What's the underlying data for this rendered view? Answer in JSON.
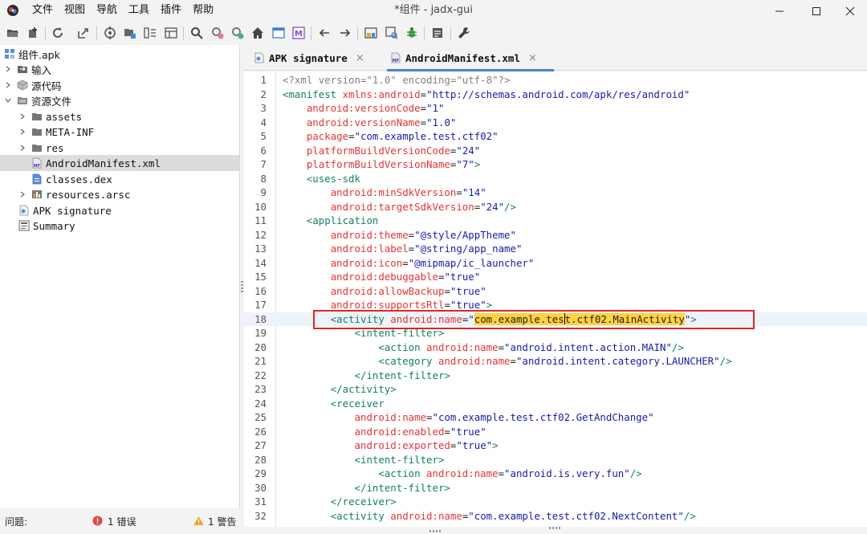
{
  "window": {
    "title": "*组件 - jadx-gui",
    "menu": [
      "文件",
      "视图",
      "导航",
      "工具",
      "插件",
      "帮助"
    ]
  },
  "toolbar": {
    "icons": [
      "open-file-icon",
      "add-files-icon",
      "reload-icon",
      "export-icon",
      "sync-icon",
      "deobfuscation-icon",
      "flatten-packages-icon",
      "columns-icon",
      "search-icon",
      "find-usage-icon",
      "find-class-icon",
      "home-icon",
      "window-icon",
      "smali-icon",
      "back-icon",
      "forward-icon",
      "log-viewer-icon",
      "quick-tab-icon",
      "debugger-icon",
      "console-icon",
      "settings-wrench-icon"
    ]
  },
  "tree": {
    "items": [
      {
        "label": "组件.apk",
        "icon": "apk-icon",
        "level": 0,
        "expandable": false
      },
      {
        "label": "输入",
        "icon": "inputs-icon",
        "level": 0,
        "expandable": true
      },
      {
        "label": "源代码",
        "icon": "package-icon",
        "level": 0,
        "expandable": true
      },
      {
        "label": "资源文件",
        "icon": "resources-folder-icon",
        "level": 0,
        "expandable": true,
        "expanded": true
      },
      {
        "label": "assets",
        "icon": "folder-icon",
        "level": 1,
        "expandable": true
      },
      {
        "label": "META-INF",
        "icon": "folder-icon",
        "level": 1,
        "expandable": true
      },
      {
        "label": "res",
        "icon": "folder-icon",
        "level": 1,
        "expandable": true
      },
      {
        "label": "AndroidManifest.xml",
        "icon": "manifest-file-icon",
        "level": 1,
        "expandable": false,
        "selected": true
      },
      {
        "label": "classes.dex",
        "icon": "dex-file-icon",
        "level": 1,
        "expandable": false
      },
      {
        "label": "resources.arsc",
        "icon": "arsc-file-icon",
        "level": 1,
        "expandable": true
      },
      {
        "label": "APK signature",
        "icon": "certificate-icon",
        "level": 0,
        "expandable": false
      },
      {
        "label": "Summary",
        "icon": "summary-icon",
        "level": 0,
        "expandable": false
      }
    ]
  },
  "tabs": [
    {
      "label": "APK signature",
      "icon": "certificate-icon",
      "close": "×",
      "active": false
    },
    {
      "label": "AndroidManifest.xml",
      "icon": "manifest-file-icon",
      "close": "×",
      "active": true
    }
  ],
  "editor": {
    "current_line": 18,
    "lines": [
      {
        "n": "1",
        "indent": 0,
        "tokens": [
          [
            "pi",
            "<?xml version=\"1.0\" encoding=\"utf-8\"?>"
          ]
        ]
      },
      {
        "n": "2",
        "indent": 0,
        "tokens": [
          [
            "tag",
            "<manifest"
          ],
          [
            "sp",
            " "
          ],
          [
            "attr",
            "xmlns:android"
          ],
          [
            "eq",
            "="
          ],
          [
            "str",
            "\"http://schemas.android.com/apk/res/android\""
          ]
        ]
      },
      {
        "n": "3",
        "indent": 4,
        "tokens": [
          [
            "attr",
            "android:versionCode"
          ],
          [
            "eq",
            "="
          ],
          [
            "str",
            "\"1\""
          ]
        ]
      },
      {
        "n": "4",
        "indent": 4,
        "tokens": [
          [
            "attr",
            "android:versionName"
          ],
          [
            "eq",
            "="
          ],
          [
            "str",
            "\"1.0\""
          ]
        ]
      },
      {
        "n": "5",
        "indent": 4,
        "tokens": [
          [
            "attr",
            "package"
          ],
          [
            "eq",
            "="
          ],
          [
            "str",
            "\"com.example.test.ctf02\""
          ]
        ]
      },
      {
        "n": "6",
        "indent": 4,
        "tokens": [
          [
            "attr",
            "platformBuildVersionCode"
          ],
          [
            "eq",
            "="
          ],
          [
            "str",
            "\"24\""
          ]
        ]
      },
      {
        "n": "7",
        "indent": 4,
        "tokens": [
          [
            "attr",
            "platformBuildVersionName"
          ],
          [
            "eq",
            "="
          ],
          [
            "str",
            "\"7\""
          ],
          [
            "tag",
            ">"
          ]
        ]
      },
      {
        "n": "8",
        "indent": 4,
        "tokens": [
          [
            "tag",
            "<uses-sdk"
          ]
        ]
      },
      {
        "n": "9",
        "indent": 8,
        "tokens": [
          [
            "attr",
            "android:minSdkVersion"
          ],
          [
            "eq",
            "="
          ],
          [
            "str",
            "\"14\""
          ]
        ]
      },
      {
        "n": "10",
        "indent": 8,
        "tokens": [
          [
            "attr",
            "android:targetSdkVersion"
          ],
          [
            "eq",
            "="
          ],
          [
            "str",
            "\"24\""
          ],
          [
            "tag",
            "/>"
          ]
        ]
      },
      {
        "n": "11",
        "indent": 4,
        "tokens": [
          [
            "tag",
            "<application"
          ]
        ]
      },
      {
        "n": "12",
        "indent": 8,
        "tokens": [
          [
            "attr",
            "android:theme"
          ],
          [
            "eq",
            "="
          ],
          [
            "str",
            "\"@style/AppTheme\""
          ]
        ]
      },
      {
        "n": "13",
        "indent": 8,
        "tokens": [
          [
            "attr",
            "android:label"
          ],
          [
            "eq",
            "="
          ],
          [
            "str",
            "\"@string/app_name\""
          ]
        ]
      },
      {
        "n": "14",
        "indent": 8,
        "tokens": [
          [
            "attr",
            "android:icon"
          ],
          [
            "eq",
            "="
          ],
          [
            "str",
            "\"@mipmap/ic_launcher\""
          ]
        ]
      },
      {
        "n": "15",
        "indent": 8,
        "tokens": [
          [
            "attr",
            "android:debuggable"
          ],
          [
            "eq",
            "="
          ],
          [
            "str",
            "\"true\""
          ]
        ]
      },
      {
        "n": "16",
        "indent": 8,
        "tokens": [
          [
            "attr",
            "android:allowBackup"
          ],
          [
            "eq",
            "="
          ],
          [
            "str",
            "\"true\""
          ]
        ]
      },
      {
        "n": "17",
        "indent": 8,
        "tokens": [
          [
            "attr",
            "android:supportsRtl"
          ],
          [
            "eq",
            "="
          ],
          [
            "str",
            "\"true\""
          ],
          [
            "tag",
            ">"
          ]
        ]
      },
      {
        "n": "18",
        "indent": 8,
        "tokens": [
          [
            "tag",
            "<activity"
          ],
          [
            "sp",
            " "
          ],
          [
            "attr",
            "android:name"
          ],
          [
            "eq",
            "="
          ],
          [
            "str",
            "\""
          ],
          [
            "sel",
            "com.example.tes"
          ],
          [
            "caret",
            ""
          ],
          [
            "sel",
            "t.ctf02.MainActivity"
          ],
          [
            "str",
            "\""
          ],
          [
            "tag",
            ">"
          ]
        ]
      },
      {
        "n": "19",
        "indent": 12,
        "tokens": [
          [
            "tag",
            "<intent-filter>"
          ]
        ]
      },
      {
        "n": "20",
        "indent": 16,
        "tokens": [
          [
            "tag",
            "<action"
          ],
          [
            "sp",
            " "
          ],
          [
            "attr",
            "android:name"
          ],
          [
            "eq",
            "="
          ],
          [
            "str",
            "\"android.intent.action.MAIN\""
          ],
          [
            "tag",
            "/>"
          ]
        ]
      },
      {
        "n": "21",
        "indent": 16,
        "tokens": [
          [
            "tag",
            "<category"
          ],
          [
            "sp",
            " "
          ],
          [
            "attr",
            "android:name"
          ],
          [
            "eq",
            "="
          ],
          [
            "str",
            "\"android.intent.category.LAUNCHER\""
          ],
          [
            "tag",
            "/>"
          ]
        ]
      },
      {
        "n": "22",
        "indent": 12,
        "tokens": [
          [
            "tag",
            "</intent-filter>"
          ]
        ]
      },
      {
        "n": "23",
        "indent": 8,
        "tokens": [
          [
            "tag",
            "</activity>"
          ]
        ]
      },
      {
        "n": "24",
        "indent": 8,
        "tokens": [
          [
            "tag",
            "<receiver"
          ]
        ]
      },
      {
        "n": "25",
        "indent": 12,
        "tokens": [
          [
            "attr",
            "android:name"
          ],
          [
            "eq",
            "="
          ],
          [
            "str",
            "\"com.example.test.ctf02.GetAndChange\""
          ]
        ]
      },
      {
        "n": "26",
        "indent": 12,
        "tokens": [
          [
            "attr",
            "android:enabled"
          ],
          [
            "eq",
            "="
          ],
          [
            "str",
            "\"true\""
          ]
        ]
      },
      {
        "n": "27",
        "indent": 12,
        "tokens": [
          [
            "attr",
            "android:exported"
          ],
          [
            "eq",
            "="
          ],
          [
            "str",
            "\"true\""
          ],
          [
            "tag",
            ">"
          ]
        ]
      },
      {
        "n": "28",
        "indent": 12,
        "tokens": [
          [
            "tag",
            "<intent-filter>"
          ]
        ]
      },
      {
        "n": "29",
        "indent": 16,
        "tokens": [
          [
            "tag",
            "<action"
          ],
          [
            "sp",
            " "
          ],
          [
            "attr",
            "android:name"
          ],
          [
            "eq",
            "="
          ],
          [
            "str",
            "\"android.is.very.fun\""
          ],
          [
            "tag",
            "/>"
          ]
        ]
      },
      {
        "n": "30",
        "indent": 12,
        "tokens": [
          [
            "tag",
            "</intent-filter>"
          ]
        ]
      },
      {
        "n": "31",
        "indent": 8,
        "tokens": [
          [
            "tag",
            "</receiver>"
          ]
        ]
      },
      {
        "n": "32",
        "indent": 8,
        "tokens": [
          [
            "tag",
            "<activity"
          ],
          [
            "sp",
            " "
          ],
          [
            "attr",
            "android:name"
          ],
          [
            "eq",
            "="
          ],
          [
            "str",
            "\"com.example.test.ctf02.NextContent\""
          ],
          [
            "tag",
            "/>"
          ]
        ]
      }
    ]
  },
  "status": {
    "problems_label": "问题:",
    "errors": "1 错误",
    "warnings": "1 警告"
  },
  "colors": {
    "tag": "#14805e",
    "attr": "#e33535",
    "string": "#1a1aa6",
    "selection": "#ffd240",
    "highlight_box": "#e02424",
    "tab_underline": "#4a7fcf"
  }
}
